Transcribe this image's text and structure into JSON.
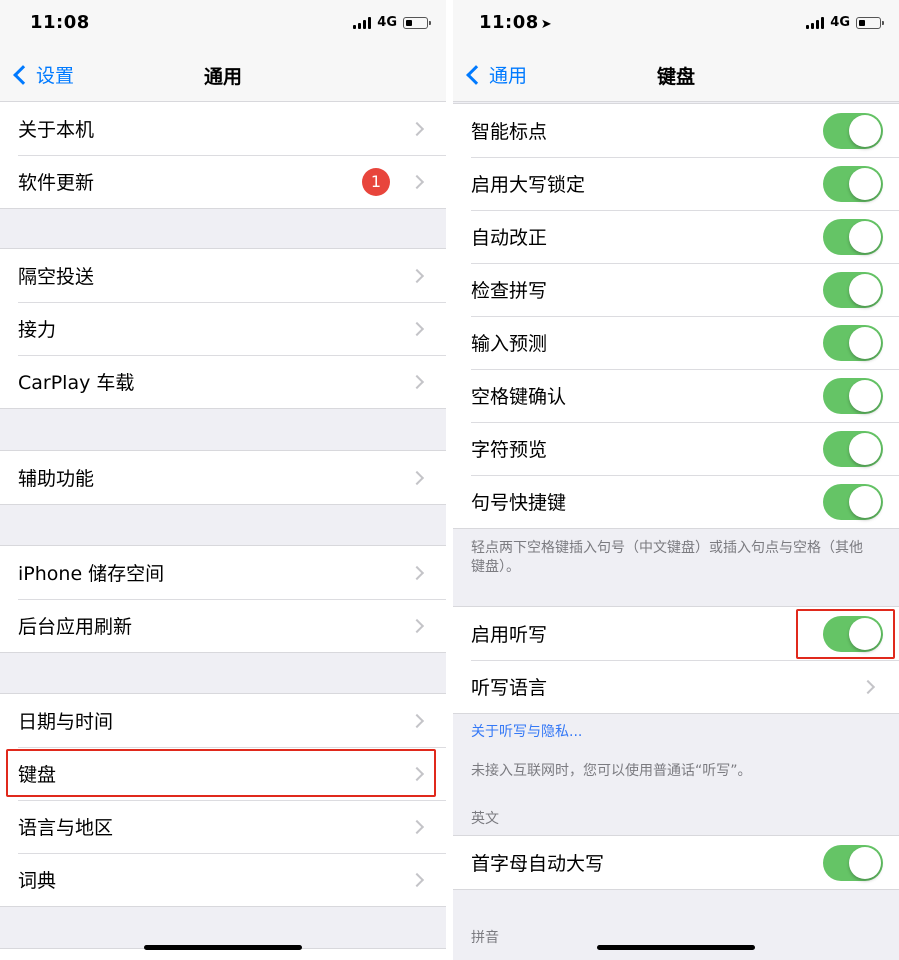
{
  "left": {
    "status": {
      "time": "11:08",
      "network": "4G",
      "battery_level": 0.25
    },
    "nav": {
      "back_label": "设置",
      "title": "通用"
    },
    "groups": [
      [
        {
          "label": "关于本机"
        },
        {
          "label": "软件更新",
          "badge": "1"
        }
      ],
      [
        {
          "label": "隔空投送"
        },
        {
          "label": "接力"
        },
        {
          "label": "CarPlay 车载"
        }
      ],
      [
        {
          "label": "辅助功能"
        }
      ],
      [
        {
          "label": "iPhone 储存空间"
        },
        {
          "label": "后台应用刷新"
        }
      ],
      [
        {
          "label": "日期与时间"
        },
        {
          "label": "键盘"
        },
        {
          "label": "语言与地区"
        },
        {
          "label": "词典"
        }
      ]
    ]
  },
  "right": {
    "status": {
      "time": "11:08",
      "network": "4G",
      "battery_level": 0.25
    },
    "nav": {
      "back_label": "通用",
      "title": "键盘"
    },
    "toggles": [
      {
        "label": "智能标点",
        "on": true
      },
      {
        "label": "启用大写锁定",
        "on": true
      },
      {
        "label": "自动改正",
        "on": true
      },
      {
        "label": "检查拼写",
        "on": true
      },
      {
        "label": "输入预测",
        "on": true
      },
      {
        "label": "空格键确认",
        "on": true
      },
      {
        "label": "字符预览",
        "on": true
      },
      {
        "label": "句号快捷键",
        "on": true
      }
    ],
    "period_shortcut_note": "轻点两下空格键插入句号（中文键盘）或插入句点与空格（其他键盘）。",
    "dictation": {
      "enable_label": "启用听写",
      "enabled": true,
      "language_label": "听写语言"
    },
    "dictation_privacy_link": "关于听写与隐私...",
    "dictation_note": "未接入互联网时，您可以使用普通话“听写”。",
    "english_header": "英文",
    "auto_capitalization": {
      "label": "首字母自动大写",
      "on": true
    },
    "pinyin_header": "拼音"
  },
  "colors": {
    "accent": "#007aff",
    "toggle_on": "#65c466",
    "badge": "#e8453c",
    "highlight": "#e0291c"
  }
}
